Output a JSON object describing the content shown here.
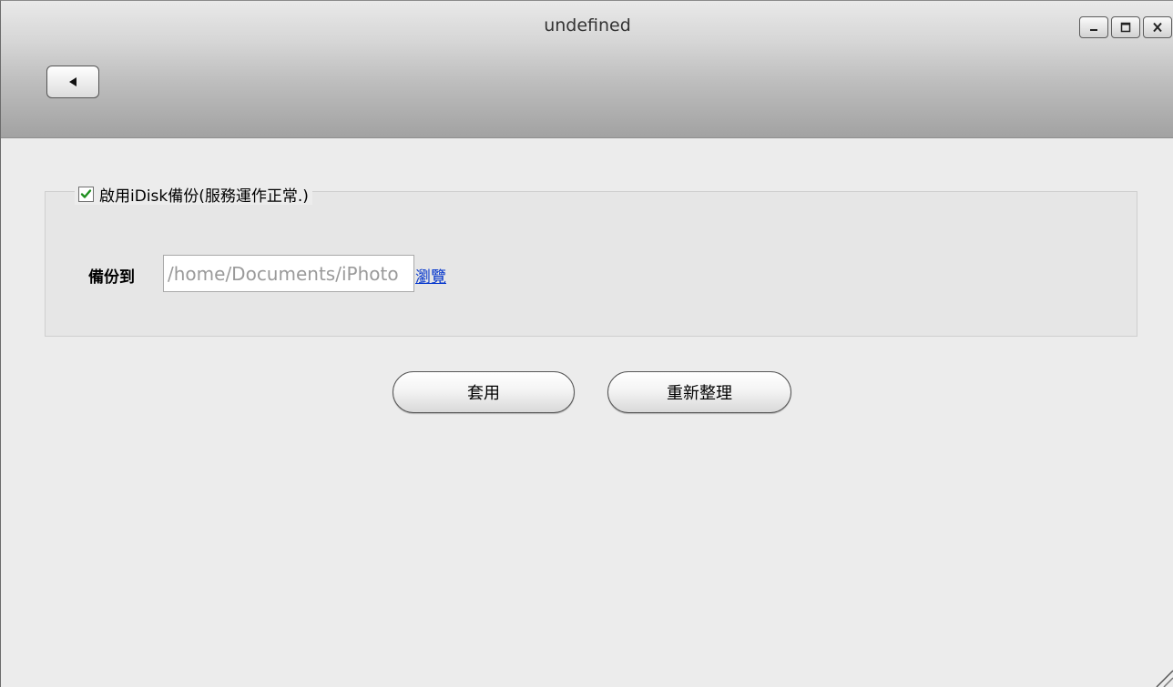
{
  "window": {
    "title": "undefined",
    "controls": [
      {
        "name": "minimize",
        "icon": "minimize-icon"
      },
      {
        "name": "maximize",
        "icon": "maximize-icon"
      },
      {
        "name": "close",
        "icon": "close-icon"
      }
    ],
    "back_icon": "back-arrow-icon"
  },
  "form": {
    "enable_checkbox": {
      "checked": true,
      "label": "啟用iDisk備份(服務運作正常.)"
    },
    "destination": {
      "label": "備份到",
      "value": "/home/Documents/iPhoto",
      "browse_label": "瀏覽"
    }
  },
  "buttons": {
    "apply_label": "套用",
    "refresh_label": "重新整理"
  },
  "colors": {
    "link": "#0033cc",
    "checkmark": "#1f8f1f",
    "background": "#ececec"
  }
}
